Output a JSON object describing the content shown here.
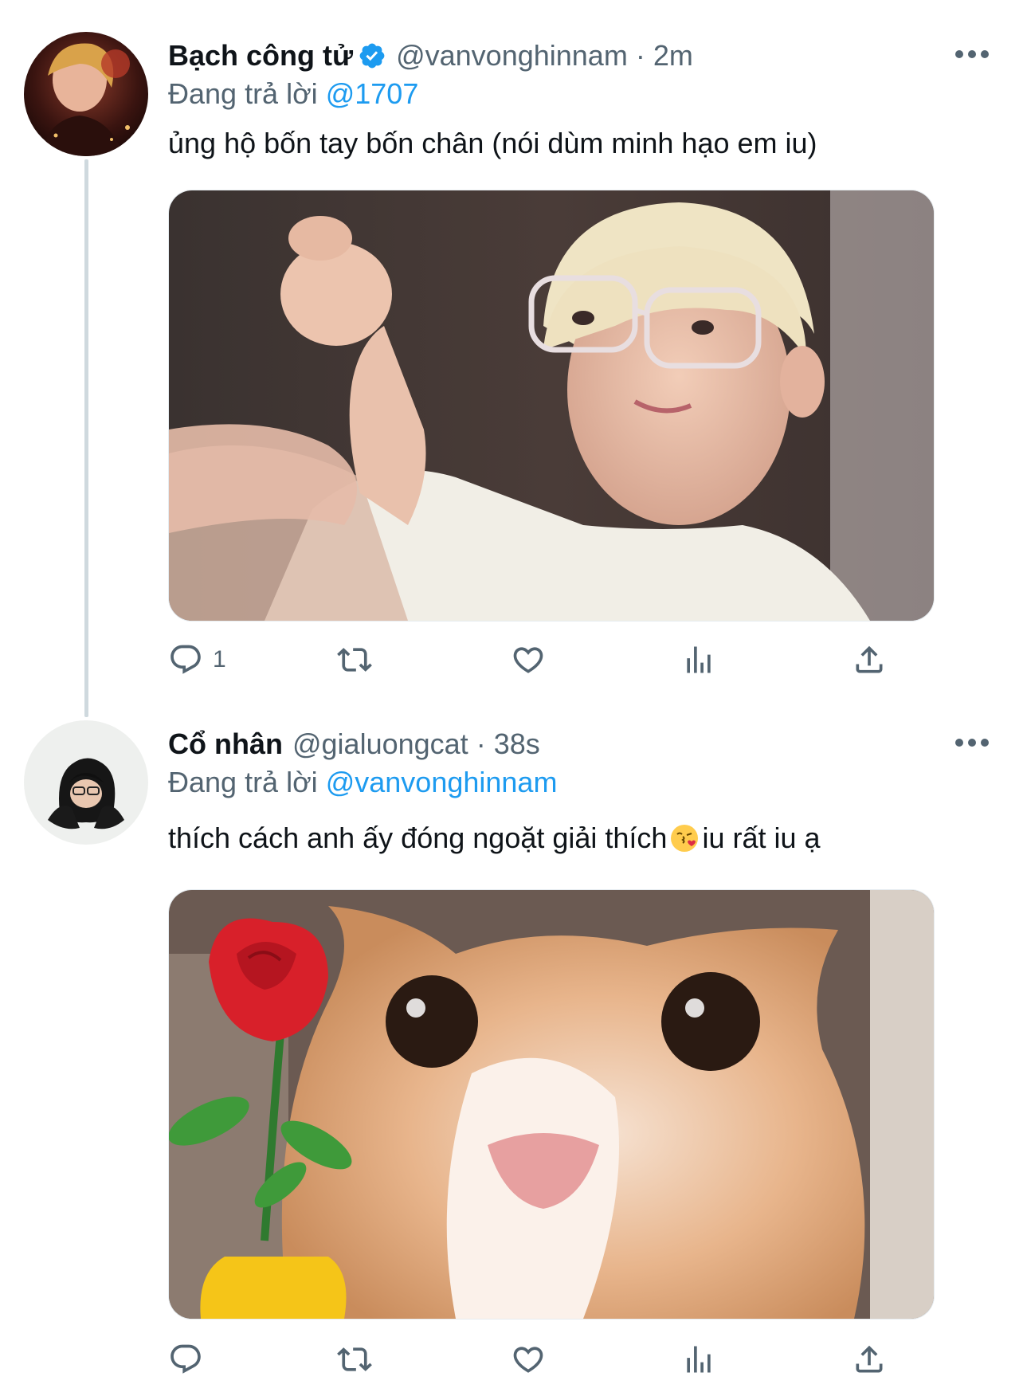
{
  "tweets": [
    {
      "name": "Bạch công tử",
      "verified": true,
      "handle": "@vanvonghinnam",
      "separator": "·",
      "time": "2m",
      "reply_prefix": "Đang trả lời",
      "reply_to": "@1707",
      "text": "ủng hộ bốn tay bốn chân (nói dùm minh hạo em iu)",
      "media_description": "photo of blond person in glasses making finger heart",
      "reply_count": "1",
      "retweet_count": "",
      "like_count": ""
    },
    {
      "name": "Cổ nhân",
      "verified": false,
      "handle": "@gialuongcat",
      "separator": "·",
      "time": "38s",
      "reply_prefix": "Đang trả lời",
      "reply_to": "@vanvonghinnam",
      "text_before_emoji": "thích cách anh ấy đóng ngoặt giải thích",
      "emoji": "face-blowing-kiss",
      "text_after_emoji": "iu rất iu ạ",
      "media_description": "cat holding a red rose",
      "reply_count": "",
      "retweet_count": "",
      "like_count": ""
    }
  ],
  "colors": {
    "link": "#1d9bf0",
    "secondary_text": "#536471",
    "primary_text": "#0f1419",
    "thread_line": "#cfd9de"
  }
}
